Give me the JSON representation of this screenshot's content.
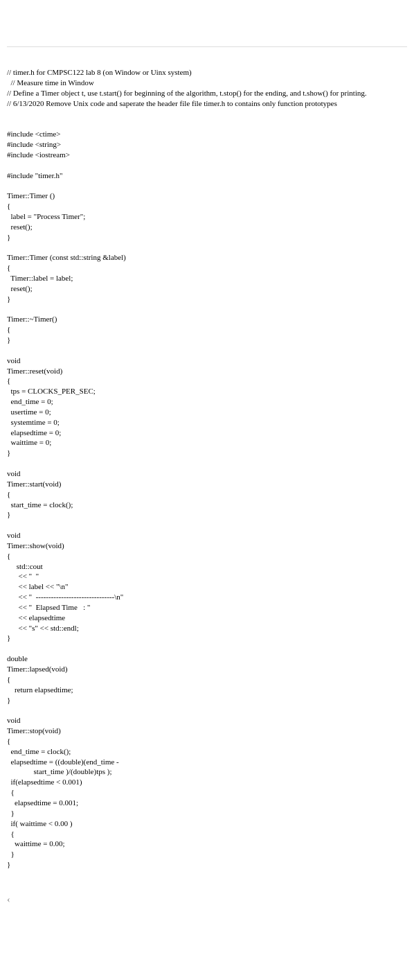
{
  "code": {
    "lines": [
      "// timer.h for CMPSC122 lab 8 (on Window or Uinx system)",
      "  // Measure time in Window",
      "// Define a Timer object t, use t.start() for beginning of the algorithm, t.stop() for the ending, and t.show() for printing.",
      "// 6/13/2020 Remove Unix code and saperate the header file file timer.h to contains only function prototypes",
      "",
      "",
      "#include <ctime>",
      "#include <string>",
      "#include <iostream>",
      "",
      "#include \"timer.h\"",
      "",
      "Timer::Timer ()",
      "{",
      "  label = \"Process Timer\";",
      "  reset();",
      "}",
      "",
      "Timer::Timer (const std::string &label)",
      "{",
      "  Timer::label = label;",
      "  reset();",
      "}",
      "",
      "Timer::~Timer()",
      "{",
      "}",
      "",
      "void",
      "Timer::reset(void)",
      "{",
      "  tps = CLOCKS_PER_SEC;",
      "  end_time = 0;",
      "  usertime = 0;",
      "  systemtime = 0;",
      "  elapsedtime = 0;",
      "  waittime = 0;",
      "}",
      "",
      "void",
      "Timer::start(void)",
      "{",
      "  start_time = clock();",
      "}",
      "",
      "void",
      "Timer::show(void)",
      "{",
      "     std::cout",
      "      << \"  \"",
      "      << label << \"\\n\"",
      "      << \"  -------------------------------\\n\"",
      "      << \"  Elapsed Time   : \"",
      "      << elapsedtime",
      "      << \"s\" << std::endl;",
      "}",
      "",
      "double",
      "Timer::lapsed(void)",
      "{",
      "    return elapsedtime;",
      "}",
      "",
      "void",
      "Timer::stop(void)",
      "{",
      "  end_time = clock();",
      "  elapsedtime = ((double)(end_time -",
      "              start_time )/(double)tps );",
      "  if(elapsedtime < 0.001)",
      "  {",
      "    elapsedtime = 0.001;",
      "  }",
      "  if( waittime < 0.00 )",
      "  {",
      "    waittime = 0.00;",
      "  }",
      "}"
    ]
  },
  "expand_icon": "‹"
}
